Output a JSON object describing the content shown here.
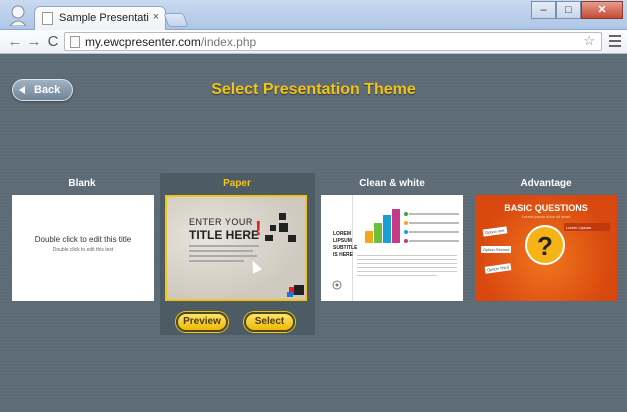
{
  "browser": {
    "tab_title": "Sample Presentation - Cre",
    "tab_close": "×",
    "url_host": "my.ewcpresenter.com",
    "url_path": "/index.php",
    "nav_back": "←",
    "nav_forward": "→",
    "nav_reload": "C",
    "star": "☆",
    "win_min": "–",
    "win_max": "□",
    "win_close": "✕"
  },
  "app": {
    "back_label": "Back",
    "title": "Select Presentation Theme",
    "accent": "#f3c316",
    "themes": [
      {
        "label": "Blank",
        "selected": false
      },
      {
        "label": "Paper",
        "selected": true
      },
      {
        "label": "Clean & white",
        "selected": false
      },
      {
        "label": "Advantage",
        "selected": false
      }
    ],
    "blank_preview": {
      "title": "Double click to edit this title",
      "subtitle": "Double click to edit this text"
    },
    "paper_preview": {
      "line1": "ENTER YOUR",
      "line2": "TITLE HERE",
      "mark": "!"
    },
    "clean_preview": {
      "big_text": "LOREM\nLIPSUM\nSUBTITLE\nIS HERE"
    },
    "advantage_preview": {
      "title": "BASIC QUESTIONS",
      "subtitle": "Lorem ipsum dolor sit amet",
      "badge": "Lorem Lipsum",
      "mark": "?",
      "options": [
        "Option one",
        "Option Second",
        "Option Third"
      ]
    },
    "preview_label": "Preview",
    "select_label": "Select"
  }
}
